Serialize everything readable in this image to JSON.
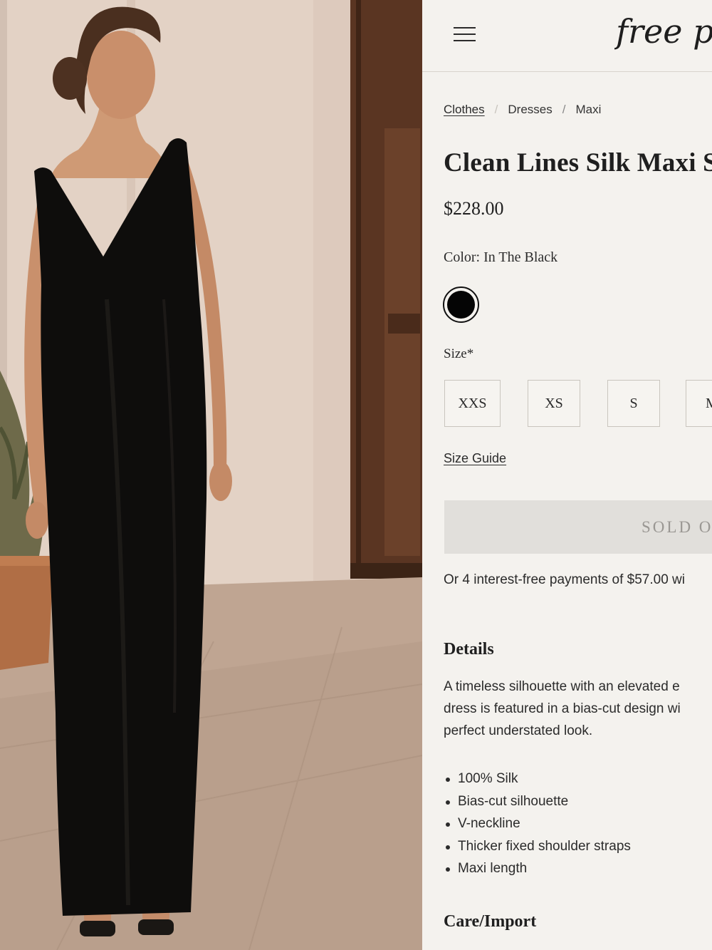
{
  "header": {
    "menu_icon": "hamburger-menu-icon",
    "logo_text": "free p"
  },
  "breadcrumb": [
    {
      "label": "Clothes"
    },
    {
      "label": "Dresses"
    },
    {
      "label": "Maxi"
    }
  ],
  "product": {
    "title": "Clean Lines Silk Maxi Sl",
    "price": "$228.00",
    "color_label": "Color:",
    "color_value": "In The Black",
    "swatch_color": "#050505",
    "size_label": "Size*",
    "sizes": [
      "XXS",
      "XS",
      "S",
      "M"
    ],
    "size_guide": "Size Guide",
    "cta": "SOLD O",
    "installments": "Or 4 interest-free payments of $57.00 wi"
  },
  "details": {
    "heading": "Details",
    "lines": [
      "A timeless silhouette with an elevated e",
      "dress is featured in a bias-cut design wi",
      "perfect understated look."
    ],
    "bullets": [
      "100% Silk",
      "Bias-cut silhouette",
      "V-neckline",
      "Thicker fixed shoulder straps",
      "Maxi length"
    ]
  },
  "care": {
    "heading": "Care/Import"
  },
  "colors": {
    "panel_bg": "#f4f2ee",
    "sold_out_bg": "#e1dfdb",
    "dress": "#0e0d0c"
  }
}
